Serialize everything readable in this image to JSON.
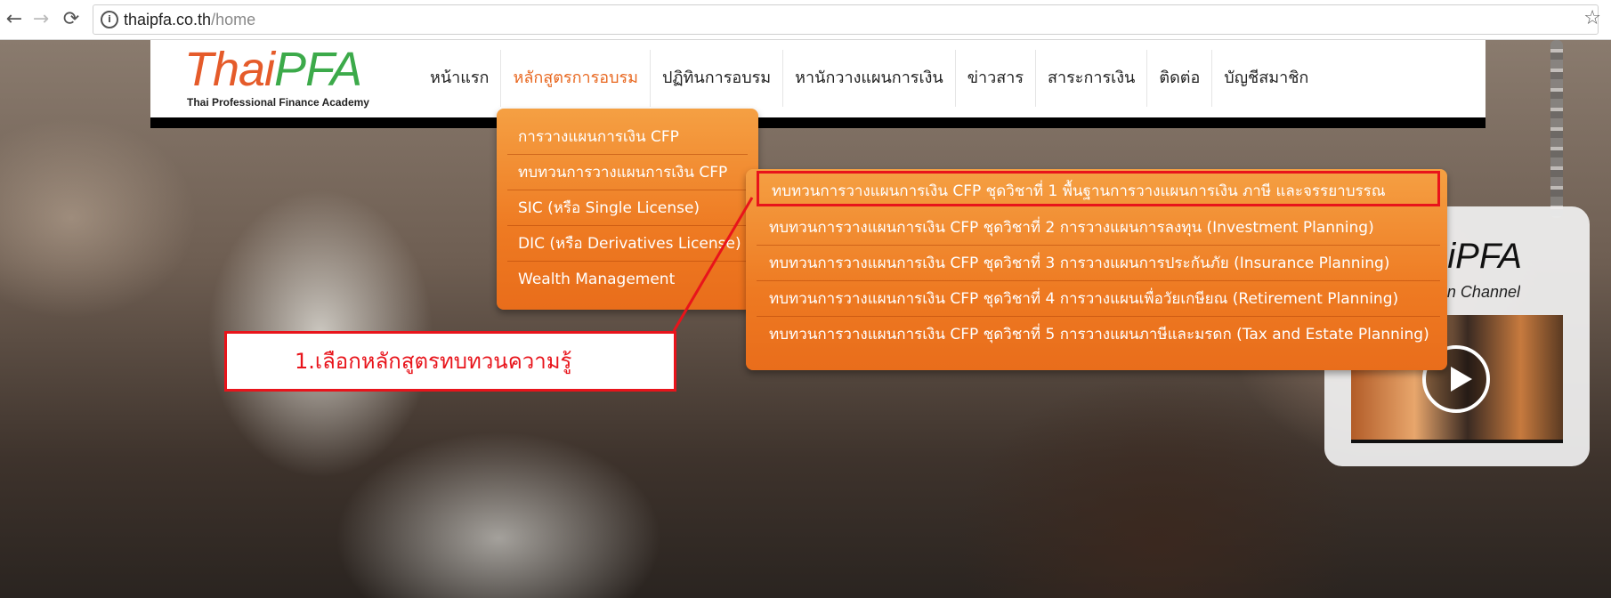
{
  "browser": {
    "back_glyph": "←",
    "forward_glyph": "→",
    "reload_glyph": "⟳",
    "url_host": "thaipfa.co.th",
    "url_path": "/home",
    "info_glyph": "i",
    "star_glyph": "☆"
  },
  "logo": {
    "text_thai": "Thai",
    "text_pfa": "PFA",
    "tagline": "Thai Professional Finance Academy"
  },
  "nav": {
    "items": [
      {
        "label": "หน้าแรก"
      },
      {
        "label": "หลักสูตรการอบรม",
        "active": true
      },
      {
        "label": "ปฏิทินการอบรม"
      },
      {
        "label": "หานักวางแผนการเงิน"
      },
      {
        "label": "ข่าวสาร"
      },
      {
        "label": "สาระการเงิน"
      },
      {
        "label": "ติดต่อ"
      },
      {
        "label": "บัญชีสมาชิก"
      }
    ]
  },
  "submenu": {
    "items": [
      {
        "label": "การวางแผนการเงิน CFP"
      },
      {
        "label": "ทบทวนการวางแผนการเงิน CFP"
      },
      {
        "label": "SIC (หรือ Single License)"
      },
      {
        "label": "DIC (หรือ Derivatives License)"
      },
      {
        "label": "Wealth Management"
      }
    ]
  },
  "subsubmenu": {
    "items": [
      {
        "label": "ทบทวนการวางแผนการเงิน CFP ชุดวิชาที่ 1 พื้นฐานการวางแผนการเงิน ภาษี และจรรยาบรรณ",
        "highlighted": true
      },
      {
        "label": "ทบทวนการวางแผนการเงิน CFP ชุดวิชาที่ 2 การวางแผนการลงทุน (Investment Planning)"
      },
      {
        "label": "ทบทวนการวางแผนการเงิน CFP ชุดวิชาที่ 3 การวางแผนการประกันภัย (Insurance Planning)"
      },
      {
        "label": "ทบทวนการวางแผนการเงิน CFP ชุดวิชาที่ 4 การวางแผนเพื่อวัยเกษียณ (Retirement Planning)"
      },
      {
        "label": "ทบทวนการวางแผนการเงิน CFP ชุดวิชาที่ 5 การวางแผนภาษีและมรดก (Tax and Estate Planning)"
      }
    ]
  },
  "annotation": {
    "text": "1.เลือกหลักสูตรทบทวนความรู้"
  },
  "video_card": {
    "title": "aiPFA",
    "subtitle": "n Channel"
  },
  "colors": {
    "accent_orange": "#ee7a22",
    "annotation_red": "#e8141b",
    "logo_orange": "#e55b2a",
    "logo_green": "#3caa4a"
  }
}
